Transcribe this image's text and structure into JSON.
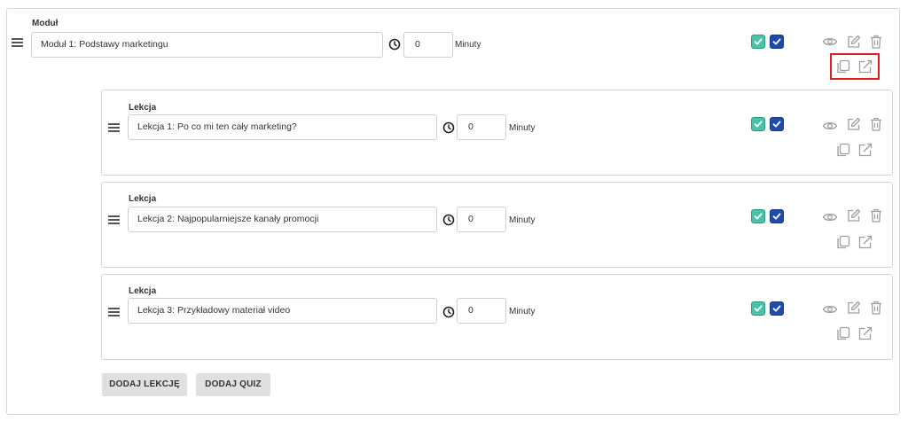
{
  "module": {
    "label": "Moduł",
    "title_value": "Moduł 1: Podstawy marketingu",
    "duration_value": "0",
    "unit": "Minuty"
  },
  "lessons": [
    {
      "label": "Lekcja",
      "title_value": "Lekcja 1: Po co mi ten cały marketing?",
      "duration_value": "0",
      "unit": "Minuty"
    },
    {
      "label": "Lekcja",
      "title_value": "Lekcja 2: Najpopularniejsze kanały promocji",
      "duration_value": "0",
      "unit": "Minuty"
    },
    {
      "label": "Lekcja",
      "title_value": "Lekcja 3: Przykładowy materiał video",
      "duration_value": "0",
      "unit": "Minuty"
    }
  ],
  "actions": {
    "add_lesson_label": "DODAJ LEKCJĘ",
    "add_quiz_label": "DODAJ QUIZ"
  },
  "colors": {
    "checkbox_green": "#4ac2a5",
    "checkbox_blue": "#1f4ba8",
    "highlight": "#e01e1e",
    "icon_gray": "#9e9e9e"
  },
  "icons": [
    "drag-handle-icon",
    "clock-icon",
    "eye-icon",
    "edit-icon",
    "trash-icon",
    "copy-icon",
    "export-icon"
  ]
}
